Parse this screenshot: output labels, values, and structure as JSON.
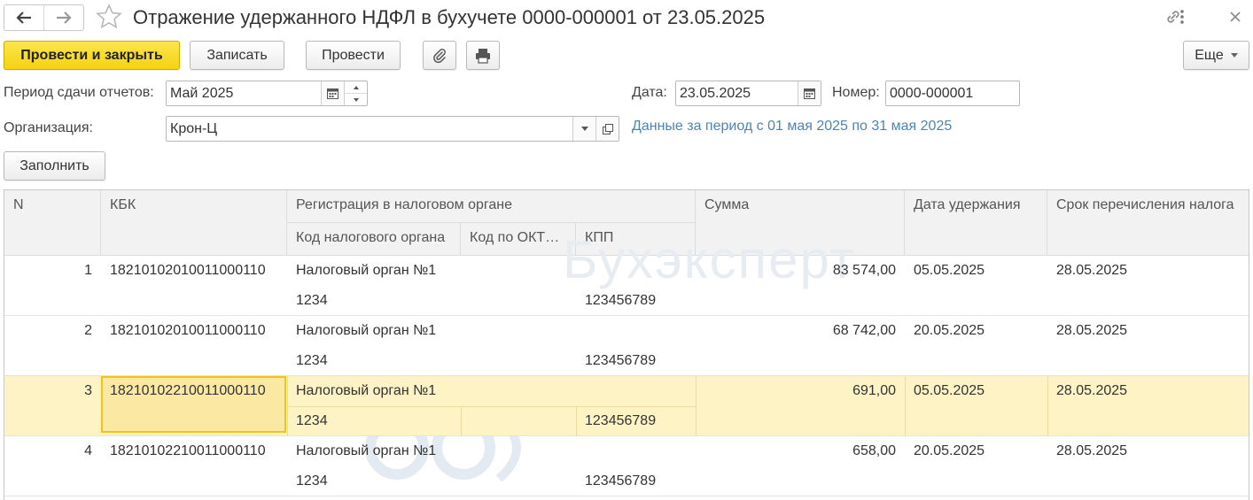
{
  "window": {
    "title": "Отражение удержанного НДФЛ в бухучете 0000-000001 от 23.05.2025"
  },
  "toolbar": {
    "post_close_label": "Провести и закрыть",
    "save_label": "Записать",
    "post_label": "Провести",
    "more_label": "Еще"
  },
  "form": {
    "period_label": "Период сдачи отчетов:",
    "period_value": "Май 2025",
    "date_label": "Дата:",
    "date_value": "23.05.2025",
    "number_label": "Номер:",
    "number_value": "0000-000001",
    "org_label": "Организация:",
    "org_value": "Крон-Ц",
    "period_info": "Данные за период с 01 мая 2025 по 31 мая 2025",
    "fill_label": "Заполнить"
  },
  "table": {
    "headers": {
      "n": "N",
      "kbk": "КБК",
      "reg": "Регистрация в налоговом органе",
      "tax_code": "Код налогового органа",
      "oktmo": "Код по ОКТ…",
      "kpp": "КПП",
      "sum": "Сумма",
      "withhold_date": "Дата удержания",
      "transfer_date": "Срок перечисления налога"
    },
    "rows": [
      {
        "n": "1",
        "kbk": "18210102010011000110",
        "reg": "Налоговый орган №1",
        "tax_code": "1234",
        "kpp": "123456789",
        "sum": "83 574,00",
        "withhold_date": "05.05.2025",
        "transfer_date": "28.05.2025"
      },
      {
        "n": "2",
        "kbk": "18210102010011000110",
        "reg": "Налоговый орган №1",
        "tax_code": "1234",
        "kpp": "123456789",
        "sum": "68 742,00",
        "withhold_date": "20.05.2025",
        "transfer_date": "28.05.2025"
      },
      {
        "n": "3",
        "kbk": "18210102210011000110",
        "reg": "Налоговый орган №1",
        "tax_code": "1234",
        "kpp": "123456789",
        "sum": "691,00",
        "withhold_date": "05.05.2025",
        "transfer_date": "28.05.2025"
      },
      {
        "n": "4",
        "kbk": "18210102210011000110",
        "reg": "Налоговый орган №1",
        "tax_code": "1234",
        "kpp": "123456789",
        "sum": "658,00",
        "withhold_date": "20.05.2025",
        "transfer_date": "28.05.2025"
      }
    ]
  },
  "watermark": {
    "text": "Бухэксперт"
  },
  "colors": {
    "primary_button": "#f5d312",
    "selected_row": "#fdf3c4",
    "selected_cell_border": "#f1c21b",
    "link": "#4d84b5"
  },
  "icons": [
    "back-arrow-icon",
    "forward-arrow-icon",
    "star-icon",
    "link-icon",
    "more-vertical-icon",
    "close-icon",
    "paperclip-icon",
    "printer-icon",
    "calendar-icon",
    "chevron-down-icon",
    "open-form-icon"
  ]
}
